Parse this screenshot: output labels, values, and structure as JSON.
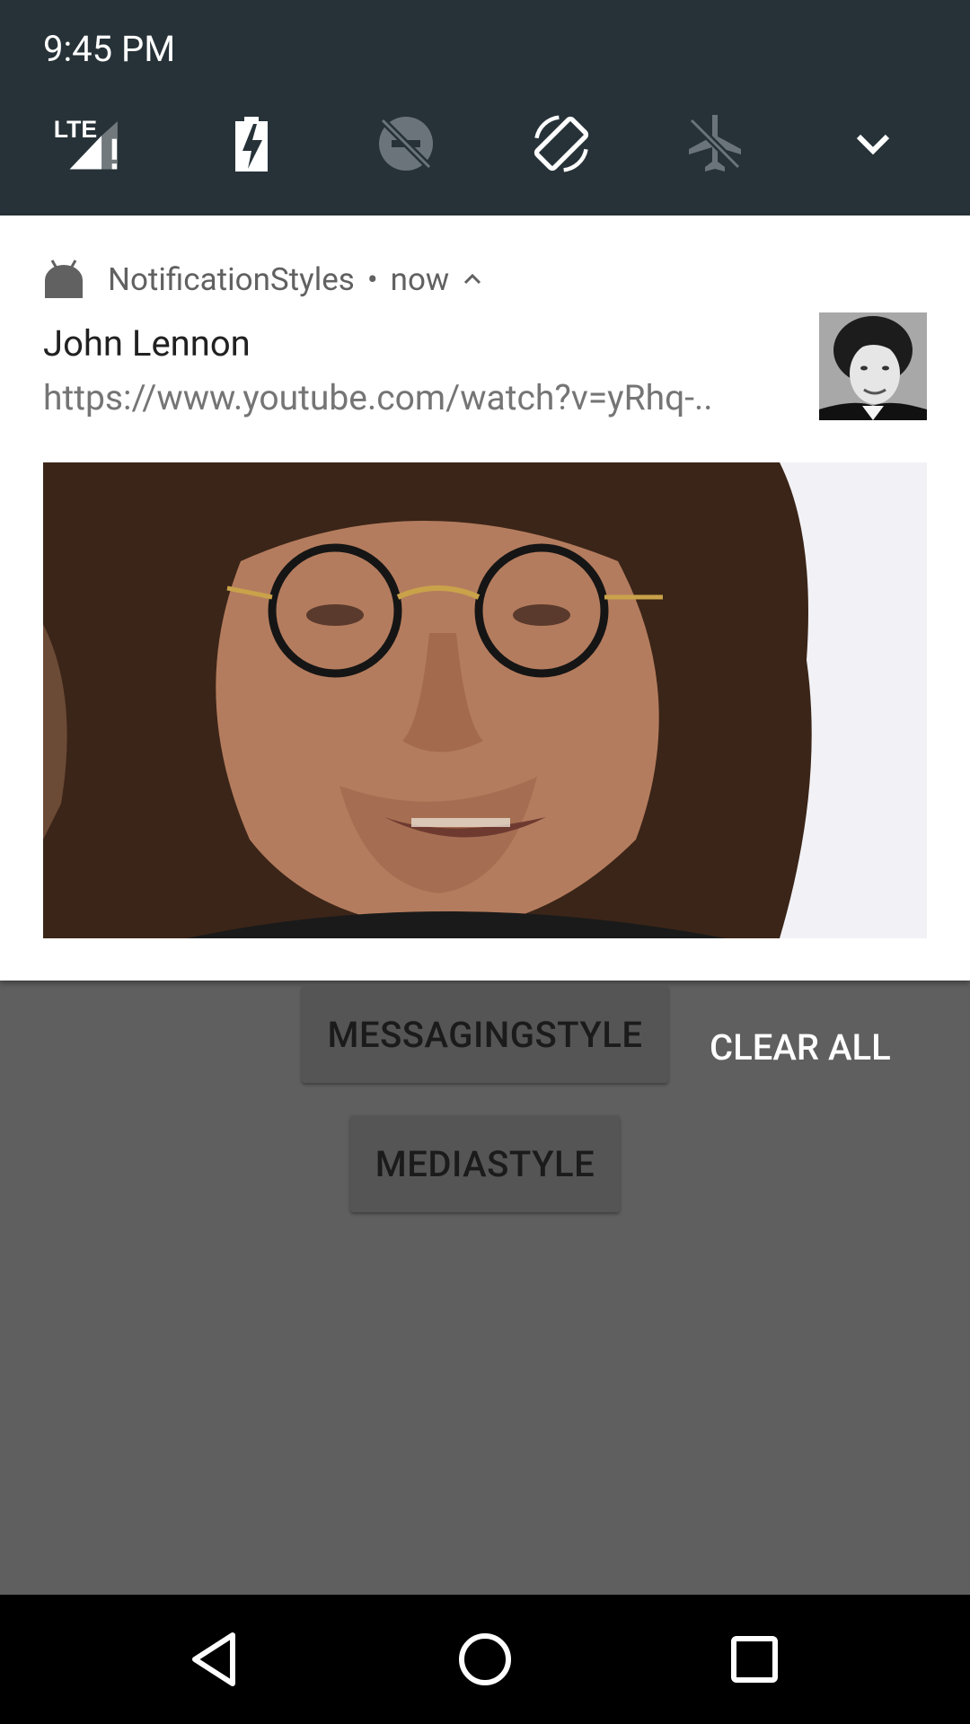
{
  "status": {
    "time": "9:45 PM",
    "tiles": [
      "lte-signal-icon",
      "battery-saver-icon",
      "dnd-off-icon",
      "auto-rotate-icon",
      "airplane-mode-icon",
      "expand-chevron-icon"
    ],
    "colors": {
      "header_bg": "#263238"
    }
  },
  "notification": {
    "app_name": "NotificationStyles",
    "separator": "•",
    "time": "now",
    "title": "John Lennon",
    "text": "https://www.youtube.com/watch?v=yRhq-..",
    "large_icon": "john-lennon-thumbnail",
    "big_picture": "john-lennon-portrait"
  },
  "app": {
    "buttons": [
      "MESSAGINGSTYLE",
      "MEDIASTYLE"
    ],
    "clear_all": "CLEAR ALL"
  },
  "navbar": {
    "buttons": [
      "back-icon",
      "home-icon",
      "recents-icon"
    ]
  }
}
